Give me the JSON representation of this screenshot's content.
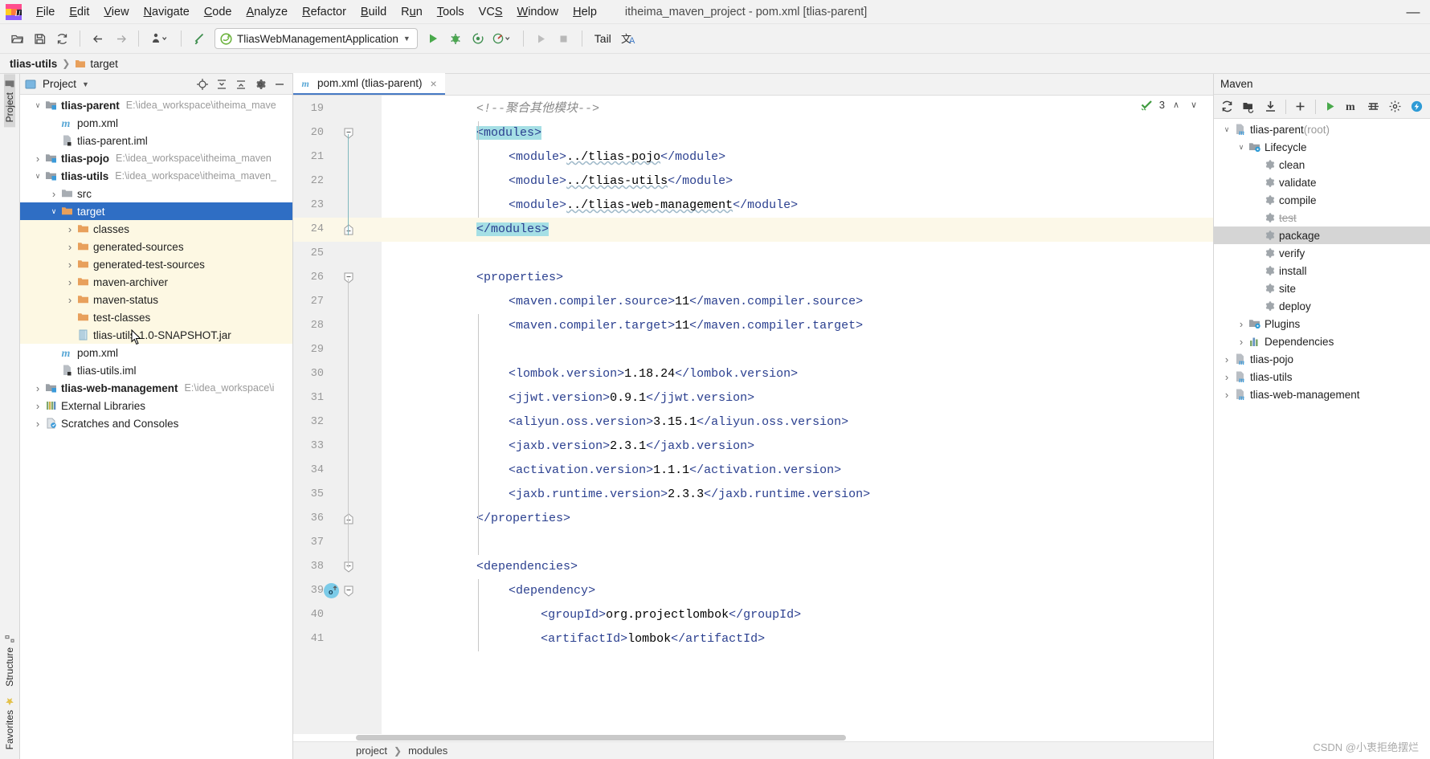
{
  "window": {
    "title": "itheima_maven_project - pom.xml [tlias-parent]",
    "minimize_label": "—"
  },
  "menubar": {
    "items": [
      {
        "label": "File",
        "mnemonic": "F"
      },
      {
        "label": "Edit",
        "mnemonic": "E"
      },
      {
        "label": "View",
        "mnemonic": "V"
      },
      {
        "label": "Navigate",
        "mnemonic": "N"
      },
      {
        "label": "Code",
        "mnemonic": "C"
      },
      {
        "label": "Analyze",
        "mnemonic": "A"
      },
      {
        "label": "Refactor",
        "mnemonic": "R"
      },
      {
        "label": "Build",
        "mnemonic": "B"
      },
      {
        "label": "Run",
        "mnemonic": "u"
      },
      {
        "label": "Tools",
        "mnemonic": "T"
      },
      {
        "label": "VCS",
        "mnemonic": "S"
      },
      {
        "label": "Window",
        "mnemonic": "W"
      },
      {
        "label": "Help",
        "mnemonic": "H"
      }
    ]
  },
  "toolbar": {
    "open_title": "Open",
    "save_title": "Save All",
    "sync_title": "Synchronize",
    "back_title": "Back",
    "forward_title": "Forward",
    "profile_title": "Profile",
    "build_title": "Build Project",
    "run_config": "TliasWebManagementApplication",
    "run_title": "Run",
    "debug_title": "Debug",
    "run_coverage_title": "Run with Coverage",
    "profiler_title": "Profiler",
    "rerun_title": "Rerun",
    "stop_title": "Stop",
    "tail_label": "Tail",
    "translate_title": "Translate"
  },
  "navbar": {
    "crumbs": [
      "tlias-utils",
      "target"
    ]
  },
  "rail": {
    "left_top": "Project",
    "left_bottom_1": "Structure",
    "left_bottom_2": "Favorites"
  },
  "project_panel": {
    "title": "Project",
    "icons": [
      "locate-icon",
      "expand-all-icon",
      "collapse-all-icon",
      "settings-gear-icon",
      "hide-icon"
    ],
    "tree": [
      {
        "depth": 0,
        "arrow": "down",
        "icon": "module-folder-icon",
        "label": "tlias-parent",
        "bold": true,
        "path": "E:\\idea_workspace\\itheima_mave",
        "state": "normal"
      },
      {
        "depth": 1,
        "arrow": "none",
        "icon": "maven-m-icon",
        "label": "pom.xml",
        "bold": false,
        "path": "",
        "state": "normal"
      },
      {
        "depth": 1,
        "arrow": "none",
        "icon": "iml-file-icon",
        "label": "tlias-parent.iml",
        "bold": false,
        "path": "",
        "state": "normal"
      },
      {
        "depth": 0,
        "arrow": "right",
        "icon": "module-folder-icon",
        "label": "tlias-pojo",
        "bold": true,
        "path": "E:\\idea_workspace\\itheima_maven",
        "state": "normal"
      },
      {
        "depth": 0,
        "arrow": "down",
        "icon": "module-folder-icon",
        "label": "tlias-utils",
        "bold": true,
        "path": "E:\\idea_workspace\\itheima_maven_",
        "state": "normal"
      },
      {
        "depth": 1,
        "arrow": "right",
        "icon": "folder-gray-icon",
        "label": "src",
        "bold": false,
        "path": "",
        "state": "normal"
      },
      {
        "depth": 1,
        "arrow": "down",
        "icon": "folder-orange-icon",
        "label": "target",
        "bold": false,
        "path": "",
        "state": "selected"
      },
      {
        "depth": 2,
        "arrow": "right",
        "icon": "folder-orange-icon",
        "label": "classes",
        "bold": false,
        "path": "",
        "state": "child"
      },
      {
        "depth": 2,
        "arrow": "right",
        "icon": "folder-orange-icon",
        "label": "generated-sources",
        "bold": false,
        "path": "",
        "state": "child"
      },
      {
        "depth": 2,
        "arrow": "right",
        "icon": "folder-orange-icon",
        "label": "generated-test-sources",
        "bold": false,
        "path": "",
        "state": "child"
      },
      {
        "depth": 2,
        "arrow": "right",
        "icon": "folder-orange-icon",
        "label": "maven-archiver",
        "bold": false,
        "path": "",
        "state": "child"
      },
      {
        "depth": 2,
        "arrow": "right",
        "icon": "folder-orange-icon",
        "label": "maven-status",
        "bold": false,
        "path": "",
        "state": "child"
      },
      {
        "depth": 2,
        "arrow": "none",
        "icon": "folder-orange-icon",
        "label": "test-classes",
        "bold": false,
        "path": "",
        "state": "child"
      },
      {
        "depth": 2,
        "arrow": "none",
        "icon": "jar-file-icon",
        "label": "tlias-utils-1.0-SNAPSHOT.jar",
        "bold": false,
        "path": "",
        "state": "child"
      },
      {
        "depth": 1,
        "arrow": "none",
        "icon": "maven-m-icon",
        "label": "pom.xml",
        "bold": false,
        "path": "",
        "state": "normal"
      },
      {
        "depth": 1,
        "arrow": "none",
        "icon": "iml-file-icon",
        "label": "tlias-utils.iml",
        "bold": false,
        "path": "",
        "state": "normal"
      },
      {
        "depth": 0,
        "arrow": "right",
        "icon": "module-folder-icon",
        "label": "tlias-web-management",
        "bold": true,
        "path": "E:\\idea_workspace\\i",
        "state": "normal"
      },
      {
        "depth": 0,
        "arrow": "right",
        "icon": "libraries-icon",
        "label": "External Libraries",
        "bold": false,
        "path": "",
        "state": "normal"
      },
      {
        "depth": 0,
        "arrow": "right",
        "icon": "scratches-icon",
        "label": "Scratches and Consoles",
        "bold": false,
        "path": "",
        "state": "normal"
      }
    ]
  },
  "editor": {
    "tab": {
      "label": "pom.xml (tlias-parent)",
      "icon": "maven-m-icon",
      "close": "×"
    },
    "inspection": {
      "count": "3",
      "icon": "inspection-ok-icon",
      "up": "∧",
      "down": "∨"
    },
    "first_line_number": 19,
    "lines": [
      {
        "n": 19,
        "indent": 0,
        "text": "<!--聚合其他模块-->",
        "kind": "comment"
      },
      {
        "n": 20,
        "indent": 0,
        "text": "<modules>",
        "kind": "tag",
        "match": true,
        "fold": "open"
      },
      {
        "n": 21,
        "indent": 1,
        "text": "<module>../tlias-pojo</module>",
        "kind": "tag",
        "squiggle": "../tlias-pojo"
      },
      {
        "n": 22,
        "indent": 1,
        "text": "<module>../tlias-utils</module>",
        "kind": "tag",
        "squiggle": "../tlias-utils"
      },
      {
        "n": 23,
        "indent": 1,
        "text": "<module>../tlias-web-management</module>",
        "kind": "tag",
        "squiggle": "../tlias-web-management"
      },
      {
        "n": 24,
        "indent": 0,
        "text": "</modules>",
        "kind": "tag",
        "match": true,
        "current": true,
        "fold": "close"
      },
      {
        "n": 25,
        "indent": 0,
        "text": "",
        "kind": "blank"
      },
      {
        "n": 26,
        "indent": 0,
        "text": "<properties>",
        "kind": "tag",
        "fold": "open"
      },
      {
        "n": 27,
        "indent": 1,
        "text": "<maven.compiler.source>11</maven.compiler.source>",
        "kind": "tag"
      },
      {
        "n": 28,
        "indent": 1,
        "text": "<maven.compiler.target>11</maven.compiler.target>",
        "kind": "tag"
      },
      {
        "n": 29,
        "indent": 0,
        "text": "",
        "kind": "blank"
      },
      {
        "n": 30,
        "indent": 1,
        "text": "<lombok.version>1.18.24</lombok.version>",
        "kind": "tag"
      },
      {
        "n": 31,
        "indent": 1,
        "text": "<jjwt.version>0.9.1</jjwt.version>",
        "kind": "tag"
      },
      {
        "n": 32,
        "indent": 1,
        "text": "<aliyun.oss.version>3.15.1</aliyun.oss.version>",
        "kind": "tag"
      },
      {
        "n": 33,
        "indent": 1,
        "text": "<jaxb.version>2.3.1</jaxb.version>",
        "kind": "tag"
      },
      {
        "n": 34,
        "indent": 1,
        "text": "<activation.version>1.1.1</activation.version>",
        "kind": "tag"
      },
      {
        "n": 35,
        "indent": 1,
        "text": "<jaxb.runtime.version>2.3.3</jaxb.runtime.version>",
        "kind": "tag"
      },
      {
        "n": 36,
        "indent": 0,
        "text": "</properties>",
        "kind": "tag",
        "fold": "close"
      },
      {
        "n": 37,
        "indent": 0,
        "text": "",
        "kind": "blank"
      },
      {
        "n": 38,
        "indent": 0,
        "text": "<dependencies>",
        "kind": "tag",
        "fold": "open"
      },
      {
        "n": 39,
        "indent": 1,
        "text": "<dependency>",
        "kind": "tag",
        "fold": "open",
        "gutter_icon": "override-o-icon"
      },
      {
        "n": 40,
        "indent": 2,
        "text": "<groupId>org.projectlombok</groupId>",
        "kind": "tag"
      },
      {
        "n": 41,
        "indent": 2,
        "text": "<artifactId>lombok</artifactId>",
        "kind": "tag"
      }
    ],
    "breadcrumb": [
      "project",
      "modules"
    ]
  },
  "maven_panel": {
    "title": "Maven",
    "tools": [
      "reload-all-icon",
      "generate-sources-icon",
      "download-sources-icon",
      "add-icon",
      "run-icon",
      "execute-goal-icon",
      "toggle-skip-tests-icon",
      "settings-icon",
      "collapse-icon"
    ],
    "tree": [
      {
        "depth": 0,
        "arrow": "down",
        "icon": "maven-project-icon",
        "label": "tlias-parent",
        "suffix": " (root)",
        "state": "normal"
      },
      {
        "depth": 1,
        "arrow": "down",
        "icon": "lifecycle-folder-icon",
        "label": "Lifecycle",
        "suffix": "",
        "state": "normal"
      },
      {
        "depth": 2,
        "arrow": "none",
        "icon": "goal-gear-icon",
        "label": "clean",
        "suffix": "",
        "state": "normal"
      },
      {
        "depth": 2,
        "arrow": "none",
        "icon": "goal-gear-icon",
        "label": "validate",
        "suffix": "",
        "state": "normal"
      },
      {
        "depth": 2,
        "arrow": "none",
        "icon": "goal-gear-icon",
        "label": "compile",
        "suffix": "",
        "state": "normal"
      },
      {
        "depth": 2,
        "arrow": "none",
        "icon": "goal-gear-icon",
        "label": "test",
        "suffix": "",
        "state": "skipped"
      },
      {
        "depth": 2,
        "arrow": "none",
        "icon": "goal-gear-icon",
        "label": "package",
        "suffix": "",
        "state": "selected"
      },
      {
        "depth": 2,
        "arrow": "none",
        "icon": "goal-gear-icon",
        "label": "verify",
        "suffix": "",
        "state": "normal"
      },
      {
        "depth": 2,
        "arrow": "none",
        "icon": "goal-gear-icon",
        "label": "install",
        "suffix": "",
        "state": "normal"
      },
      {
        "depth": 2,
        "arrow": "none",
        "icon": "goal-gear-icon",
        "label": "site",
        "suffix": "",
        "state": "normal"
      },
      {
        "depth": 2,
        "arrow": "none",
        "icon": "goal-gear-icon",
        "label": "deploy",
        "suffix": "",
        "state": "normal"
      },
      {
        "depth": 1,
        "arrow": "right",
        "icon": "plugins-folder-icon",
        "label": "Plugins",
        "suffix": "",
        "state": "normal"
      },
      {
        "depth": 1,
        "arrow": "right",
        "icon": "dependencies-icon",
        "label": "Dependencies",
        "suffix": "",
        "state": "normal"
      },
      {
        "depth": 0,
        "arrow": "right",
        "icon": "maven-project-icon",
        "label": "tlias-pojo",
        "suffix": "",
        "state": "normal"
      },
      {
        "depth": 0,
        "arrow": "right",
        "icon": "maven-project-icon",
        "label": "tlias-utils",
        "suffix": "",
        "state": "normal"
      },
      {
        "depth": 0,
        "arrow": "right",
        "icon": "maven-project-icon",
        "label": "tlias-web-management",
        "suffix": "",
        "state": "normal"
      }
    ]
  },
  "watermark": "CSDN @小衷拒绝摆烂",
  "colors": {
    "selection_blue": "#2f6ec4",
    "child_highlight": "#fdf8e3",
    "current_line": "#fcf8e8",
    "brace_match": "#a5dfe5",
    "tag_blue": "#2a3f8f",
    "folder_orange": "#e8a05c",
    "accent_green": "#3f9b3f"
  }
}
